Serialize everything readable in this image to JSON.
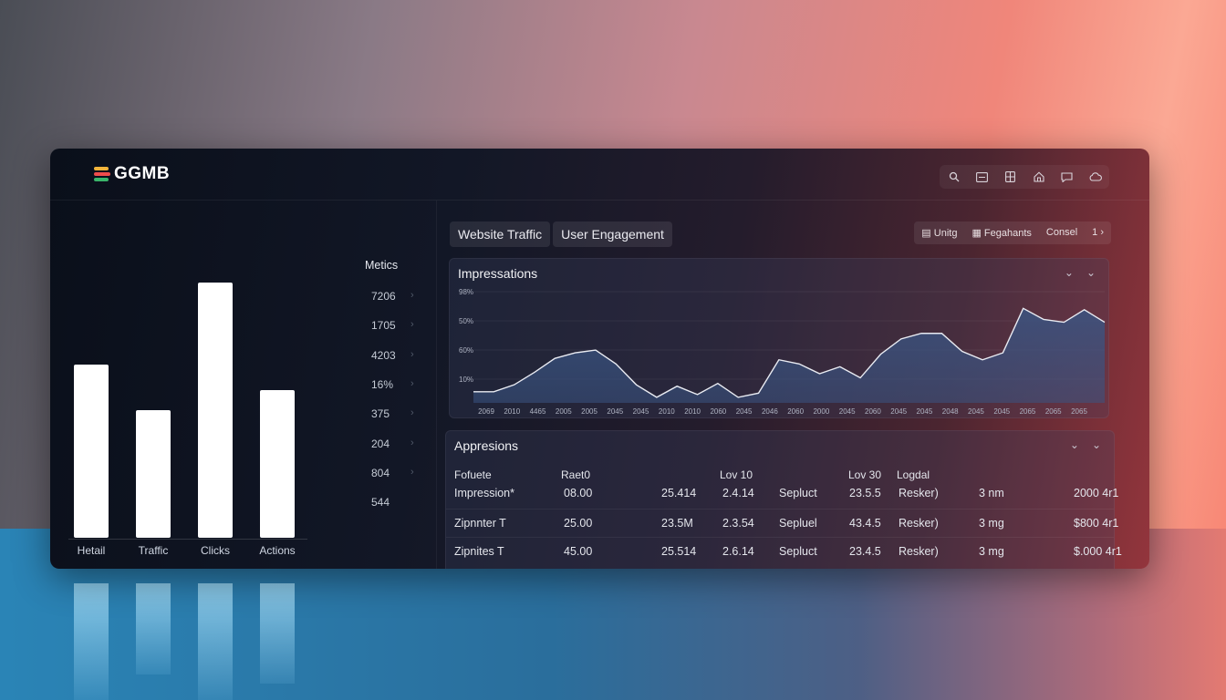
{
  "brand": {
    "name": "GGMB",
    "logo_colors": [
      "#f2b43b",
      "#ef4c4c",
      "#3ab56b"
    ]
  },
  "toolbar_icons": [
    "search-icon",
    "chart-icon",
    "grid-icon",
    "home-icon",
    "chat-icon",
    "cloud-icon"
  ],
  "left_chart": {
    "categories": [
      "Hetail",
      "Traffic",
      "Clicks",
      "Actions"
    ],
    "values": [
      0.68,
      0.5,
      1.0,
      0.58
    ],
    "bar_color": "#ffffff"
  },
  "metrics": {
    "title": "Metics",
    "items": [
      "7206",
      "1705",
      "4203",
      "16%",
      "375",
      "204",
      "804",
      "544"
    ]
  },
  "tabs": [
    "Website Traffic",
    "User Engagement"
  ],
  "actions": [
    {
      "label": "Unitg",
      "icon": "doc-icon"
    },
    {
      "label": "Fegahants",
      "icon": "file-icon"
    },
    {
      "label": "Consel",
      "icon": ""
    },
    {
      "label": "1 ›",
      "icon": ""
    }
  ],
  "impressions": {
    "title": "Impressations",
    "chart_data": {
      "type": "area",
      "y_ticks": [
        "98%",
        "50%",
        "60%",
        "10%"
      ],
      "x_ticks": [
        "2069",
        "2010",
        "4465",
        "2005",
        "2005",
        "2045",
        "2045",
        "2010",
        "2010",
        "2060",
        "2045",
        "2046",
        "2060",
        "2000",
        "2045",
        "2060",
        "2045",
        "2045",
        "2048",
        "2045",
        "2045",
        "2065",
        "2065",
        "2065"
      ],
      "x": [
        0,
        1,
        2,
        3,
        4,
        5,
        6,
        7,
        8,
        9,
        10,
        11,
        12,
        13,
        14,
        15,
        16,
        17,
        18,
        19,
        20,
        21,
        22,
        23,
        24,
        25,
        26,
        27,
        28,
        29,
        30,
        31
      ],
      "values": [
        8,
        8,
        13,
        22,
        32,
        36,
        38,
        28,
        13,
        4,
        12,
        6,
        14,
        4,
        7,
        31,
        28,
        21,
        26,
        18,
        35,
        46,
        50,
        50,
        37,
        31,
        36,
        68,
        60,
        58,
        67,
        58
      ],
      "line_color": "#e9ebf2",
      "fill_color": "#3a5482"
    }
  },
  "appresions": {
    "title": "Appresions",
    "headers": [
      "Fofuete",
      "Raet0",
      "Lov 10",
      "Lov 30",
      "Logdal"
    ],
    "rows": [
      [
        "Impression*",
        "08.00",
        "25.414",
        "2.4.14",
        "Sepluct",
        "23.5.5",
        "Resker)",
        "3 nm",
        "2000 4r1"
      ],
      [
        "Zipnnter T",
        "25.00",
        "23.5M",
        "2.3.54",
        "Sepluel",
        "43.4.5",
        "Resker)",
        "3 mg",
        "$800 4r1"
      ],
      [
        "Zipnites T",
        "45.00",
        "25.514",
        "2.6.14",
        "Sepluct",
        "23.4.5",
        "Resker)",
        "3 mg",
        "$.000 4r1"
      ]
    ]
  }
}
